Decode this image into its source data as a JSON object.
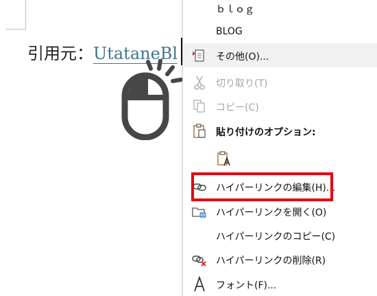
{
  "document": {
    "text_prefix": "引用元：",
    "link_text": "UtataneBl"
  },
  "context_menu": {
    "items": [
      {
        "label": "ｂｌｏｇ",
        "icon": "none",
        "enabled": true
      },
      {
        "label": "BLOG",
        "icon": "none",
        "enabled": true
      },
      {
        "label": "その他(O)...",
        "icon": "more-options-icon",
        "enabled": true
      },
      {
        "label": "切り取り(T)",
        "icon": "scissors-icon",
        "enabled": false
      },
      {
        "label": "コピー(C)",
        "icon": "copy-icon",
        "enabled": false
      },
      {
        "label": "貼り付けのオプション:",
        "icon": "clipboard-icon",
        "enabled": true
      },
      {
        "label": "",
        "icon": "paste-text-only-icon",
        "enabled": true
      },
      {
        "label": "ハイパーリンクの編集(H)...",
        "icon": "edit-hyperlink-icon",
        "enabled": true
      },
      {
        "label": "ハイパーリンクを開く(O)",
        "icon": "open-hyperlink-icon",
        "enabled": true
      },
      {
        "label": "ハイパーリンクのコピー(C)",
        "icon": "none",
        "enabled": true
      },
      {
        "label": "ハイパーリンクの削除(R)",
        "icon": "remove-hyperlink-icon",
        "enabled": true
      },
      {
        "label": "フォント(F)...",
        "icon": "font-icon",
        "enabled": true
      }
    ]
  },
  "colors": {
    "highlight": "#e60012",
    "hyperlink": "#41758a",
    "disabled_text": "#a6a6a6"
  }
}
